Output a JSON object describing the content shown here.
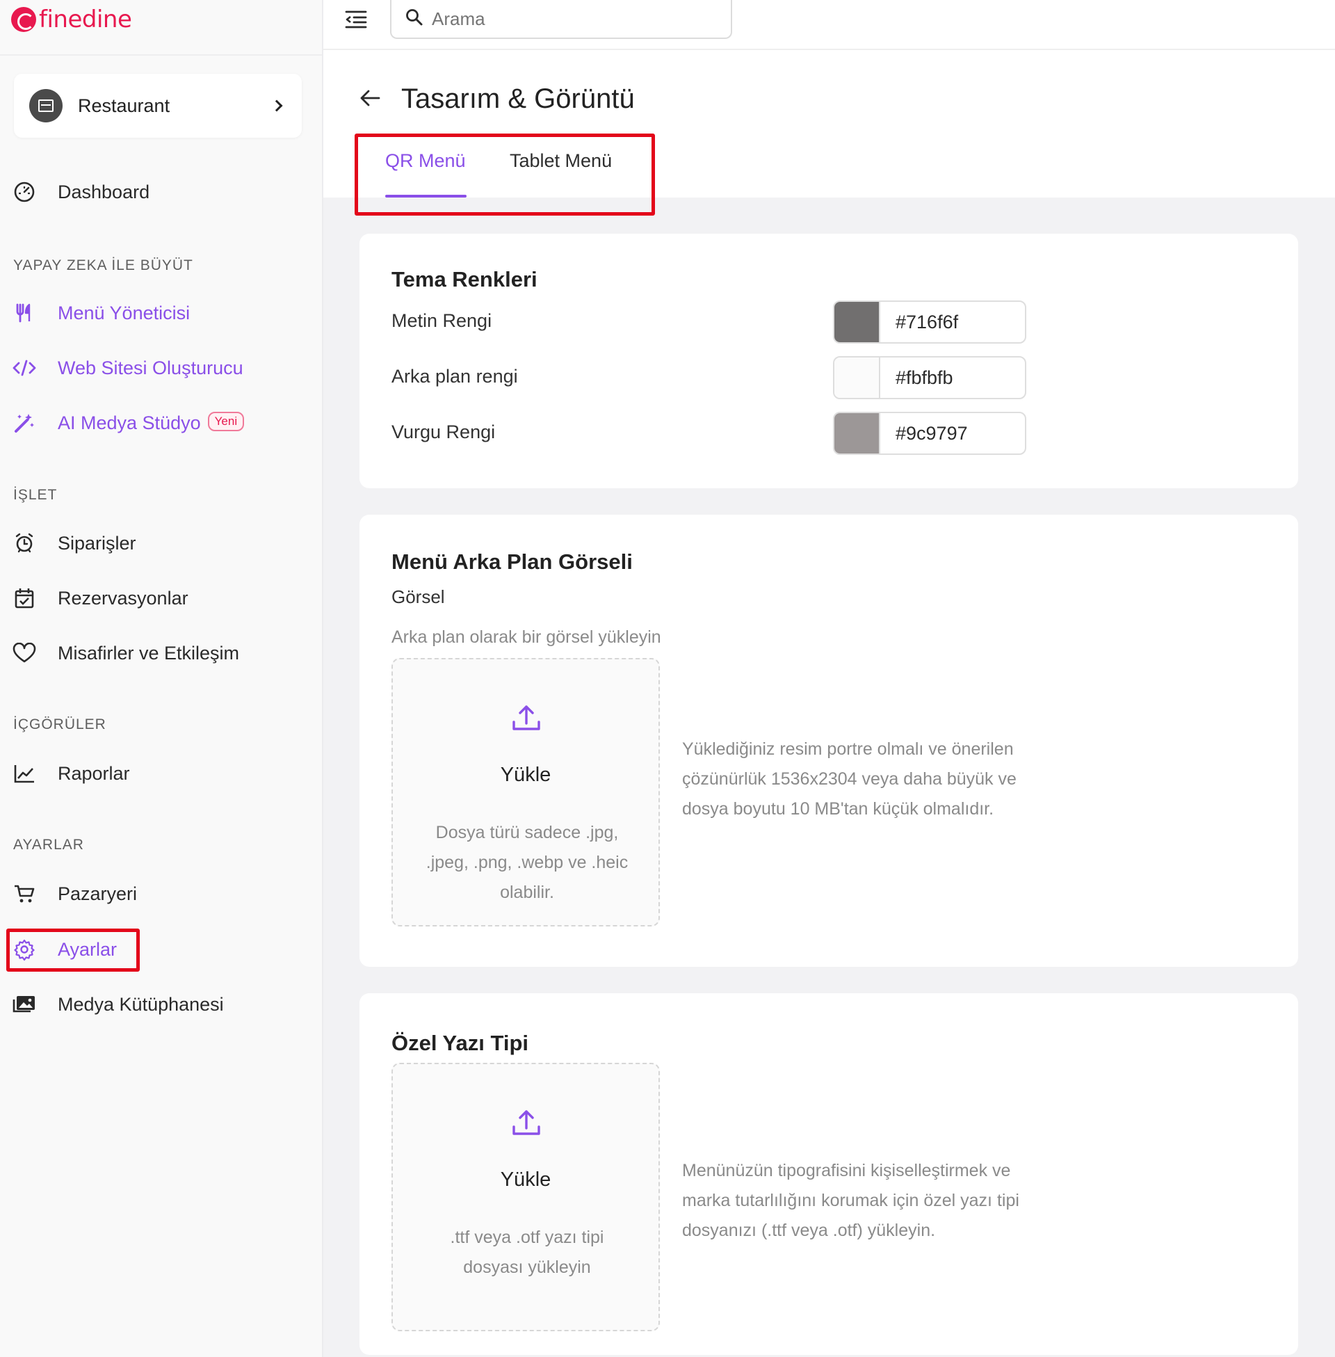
{
  "brand": {
    "name": "finedine",
    "color": "#e8194f"
  },
  "accent_color": "#8a4fe8",
  "restaurant": {
    "name": "Restaurant",
    "icon": "store-icon"
  },
  "sidebar": {
    "dashboard": "Dashboard",
    "sections": {
      "ai": "YAPAY ZEKA İLE BÜYÜT",
      "operate": "İŞLET",
      "insights": "İÇGÖRÜLER",
      "settings": "AYARLAR"
    },
    "items": {
      "menu_manager": "Menü Yöneticisi",
      "website_builder": "Web Sitesi Oluşturucu",
      "ai_media_studio": "AI Medya Stüdyo",
      "ai_media_badge": "Yeni",
      "orders": "Siparişler",
      "reservations": "Rezervasyonlar",
      "guests": "Misafirler ve Etkileşim",
      "reports": "Raporlar",
      "marketplace": "Pazaryeri",
      "settings": "Ayarlar",
      "media_library": "Medya Kütüphanesi"
    }
  },
  "search": {
    "placeholder": "Arama"
  },
  "page": {
    "title": "Tasarım & Görüntü",
    "tabs": [
      {
        "label": "QR Menü",
        "active": true
      },
      {
        "label": "Tablet Menü",
        "active": false
      }
    ]
  },
  "theme_colors": {
    "title": "Tema Renkleri",
    "fields": [
      {
        "label": "Metin Rengi",
        "value": "#716f6f"
      },
      {
        "label": "Arka plan rengi",
        "value": "#fbfbfb"
      },
      {
        "label": "Vurgu Rengi",
        "value": "#9c9797"
      }
    ]
  },
  "background_image": {
    "title": "Menü Arka Plan Görseli",
    "subtitle": "Görsel",
    "hint": "Arka plan olarak bir görsel yükleyin",
    "upload_label": "Yükle",
    "upload_hint": "Dosya türü sadece .jpg, .jpeg, .png, .webp ve .heic olabilir.",
    "note": "Yüklediğiniz resim portre olmalı ve önerilen çözünürlük 1536x2304 veya daha büyük ve dosya boyutu 10 MB'tan küçük olmalıdır."
  },
  "custom_font": {
    "title": "Özel Yazı Tipi",
    "upload_label": "Yükle",
    "upload_hint": ".ttf veya .otf yazı tipi dosyası yükleyin",
    "note": "Menünüzün tipografisini kişiselleştirmek ve marka tutarlılığını korumak için özel yazı tipi dosyanızı (.ttf veya .otf) yükleyin."
  }
}
